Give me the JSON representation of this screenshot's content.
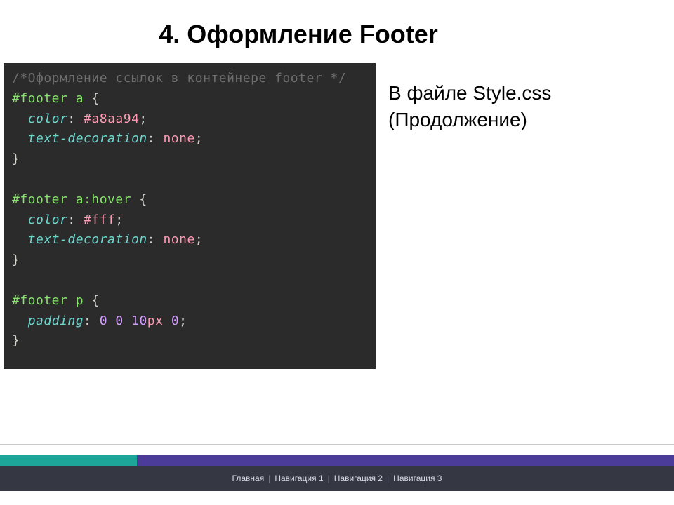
{
  "title": "4. Оформление Footer",
  "side": {
    "line1": "В файле Style.css",
    "line2": "(Продолжение)"
  },
  "code": {
    "comment": "/*Оформление ссылок в контейнере footer */",
    "r1_sel": "#footer a",
    "brace_open": " {",
    "r1_p1": "color",
    "r1_v1": "#a8aa94",
    "r1_p2": "text-decoration",
    "r1_v2": "none",
    "brace_close": "}",
    "r2_sel": "#footer a",
    "r2_pseudo": ":hover",
    "r2_p1": "color",
    "r2_v1": "#fff",
    "r2_p2": "text-decoration",
    "r2_v2": "none",
    "r3_sel": "#footer p",
    "r3_p1": "padding",
    "r3_num_a": "0",
    "r3_num_b": "0",
    "r3_num_c": "10",
    "r3_unit": "px",
    "r3_num_d": "0",
    "semi": ";",
    "colon": ": "
  },
  "footer_nav": {
    "items": [
      "Главная",
      "Навигация 1",
      "Навигация 2",
      "Навигация 3"
    ],
    "sep": " | "
  }
}
